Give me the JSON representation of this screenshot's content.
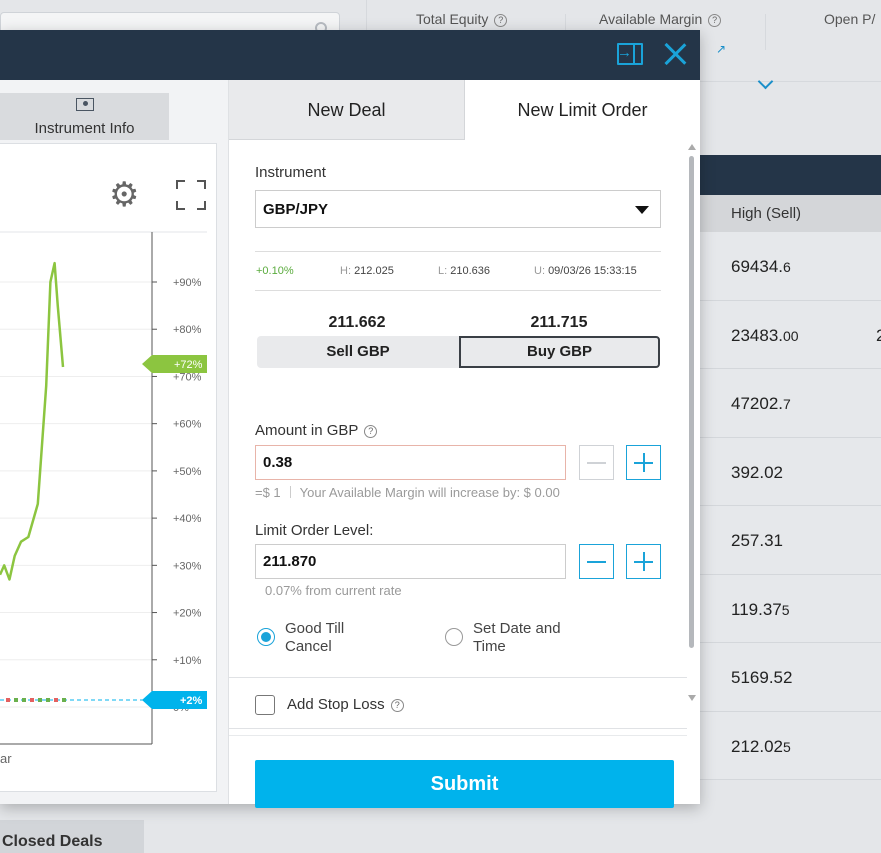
{
  "background": {
    "stats": [
      {
        "label": "Total Equity"
      },
      {
        "label": "Available Margin"
      },
      {
        "label": "Open P/"
      }
    ],
    "margin_link": "0",
    "table": {
      "column_header": "High (Sell)",
      "rows": [
        {
          "main": "69434.",
          "small": "6",
          "edge": ""
        },
        {
          "main": "23483.",
          "small": "00",
          "edge": "2"
        },
        {
          "main": "47202.",
          "small": "7",
          "edge": ""
        },
        {
          "main": "392.02",
          "small": "",
          "edge": ""
        },
        {
          "main": "257.31",
          "small": "",
          "edge": ""
        },
        {
          "main": "119.37",
          "small": "5",
          "edge": ""
        },
        {
          "main": "5169.52",
          "small": "",
          "edge": ""
        },
        {
          "main": "212.02",
          "small": "5",
          "edge": ""
        }
      ]
    },
    "closed_tab": "Closed Deals"
  },
  "modal": {
    "instrument_info_tab": "Instrument Info",
    "tabs": {
      "new_deal": "New Deal",
      "new_limit_order": "New Limit Order"
    },
    "instrument_label": "Instrument",
    "instrument_value": "GBP/JPY",
    "stats": {
      "change": "+0.10%",
      "high_key": "H:",
      "high": "212.025",
      "low_key": "L:",
      "low": "210.636",
      "updated_key": "U:",
      "updated": "09/03/26 15:33:15"
    },
    "sell_price": "211.662",
    "buy_price": "211.715",
    "sell_label": "Sell GBP",
    "buy_label": "Buy GBP",
    "amount_label": "Amount in GBP",
    "amount_value": "0.38",
    "amount_hint_usd": "=$ 1",
    "amount_hint_margin": "Your Available Margin will increase by: $ 0.00",
    "limit_label": "Limit Order Level:",
    "limit_value": "211.870",
    "limit_hint": "0.07% from current rate",
    "radio_gtc": "Good Till Cancel",
    "radio_gtc_line1": "Good Till",
    "radio_gtc_line2": "Cancel",
    "radio_date_line1": "Set Date and",
    "radio_date_line2": "Time",
    "stop_loss_label": "Add Stop Loss",
    "submit_label": "Submit"
  },
  "chart_data": {
    "type": "line",
    "series": [
      {
        "values": [
          {
            "x": 0,
            "y": 28
          },
          {
            "x": 4,
            "y": 30
          },
          {
            "x": 9,
            "y": 27
          },
          {
            "x": 14,
            "y": 32
          },
          {
            "x": 20,
            "y": 35
          },
          {
            "x": 27,
            "y": 36
          },
          {
            "x": 36,
            "y": 43
          },
          {
            "x": 44,
            "y": 68
          },
          {
            "x": 48,
            "y": 90
          },
          {
            "x": 52,
            "y": 94
          },
          {
            "x": 55,
            "y": 85
          },
          {
            "x": 60,
            "y": 72
          }
        ]
      }
    ],
    "y_ticks": [
      "+90%",
      "+80%",
      "+70%",
      "+60%",
      "+50%",
      "+40%",
      "+30%",
      "+20%",
      "+10%",
      "0%"
    ],
    "y_range": [
      0,
      90
    ],
    "current_label": "+72%",
    "baseline_label": "+2%",
    "x_tick_fragment": "ar",
    "colors": {
      "line": "#8cc540",
      "baseline": "#00b3ec",
      "current_tag": "#8cc540"
    }
  }
}
